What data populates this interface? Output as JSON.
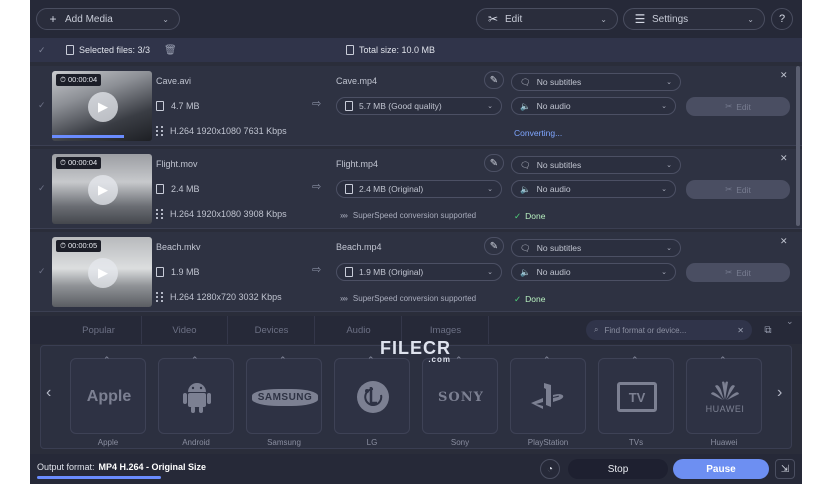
{
  "toolbar": {
    "add_media": "Add Media",
    "edit": "Edit",
    "settings": "Settings",
    "help": "?"
  },
  "selection": {
    "selected_files": "Selected files: 3/3",
    "total_size": "Total size: 10.0 MB"
  },
  "files": [
    {
      "duration": "00:00:04",
      "source_name": "Cave.avi",
      "source_size": "4.7 MB",
      "source_codec": "H.264 1920x1080 7631 Kbps",
      "output_name": "Cave.mp4",
      "output_size": "5.7 MB (Good quality)",
      "subtitles": "No subtitles",
      "audio": "No audio",
      "status": "Converting...",
      "edit_label": "Edit",
      "progress": 0.72
    },
    {
      "duration": "00:00:04",
      "source_name": "Flight.mov",
      "source_size": "2.4 MB",
      "source_codec": "H.264 1920x1080 3908 Kbps",
      "output_name": "Flight.mp4",
      "output_size": "2.4 MB (Original)",
      "subtitles": "No subtitles",
      "audio": "No audio",
      "speed_note": "SuperSpeed conversion supported",
      "status": "Done",
      "edit_label": "Edit"
    },
    {
      "duration": "00:00:05",
      "source_name": "Beach.mkv",
      "source_size": "1.9 MB",
      "source_codec": "H.264 1280x720 3032 Kbps",
      "output_name": "Beach.mp4",
      "output_size": "1.9 MB (Original)",
      "subtitles": "No subtitles",
      "audio": "No audio",
      "speed_note": "SuperSpeed conversion supported",
      "status": "Done",
      "edit_label": "Edit"
    }
  ],
  "categories": {
    "tabs": [
      "Popular",
      "Video",
      "Devices",
      "Audio",
      "Images"
    ],
    "search_placeholder": "Find format or device..."
  },
  "devices": [
    {
      "label": "Apple",
      "logo_text": "Apple"
    },
    {
      "label": "Android",
      "logo_text": ""
    },
    {
      "label": "Samsung",
      "logo_text": "SAMSUNG"
    },
    {
      "label": "LG",
      "logo_text": ""
    },
    {
      "label": "Sony",
      "logo_text": "SONY"
    },
    {
      "label": "PlayStation",
      "logo_text": ""
    },
    {
      "label": "TVs",
      "logo_text": "TV"
    },
    {
      "label": "Huawei",
      "logo_text": "HUAWEI"
    }
  ],
  "watermark": {
    "main": "FILECR",
    "sub": ".com"
  },
  "bottom": {
    "output_format_label": "Output format:",
    "output_format_value": "MP4 H.264 - Original Size",
    "stop": "Stop",
    "pause": "Pause"
  },
  "colors": {
    "accent": "#6d8ff2",
    "background": "#2a2d3a",
    "done_check": "#4fd47a"
  }
}
